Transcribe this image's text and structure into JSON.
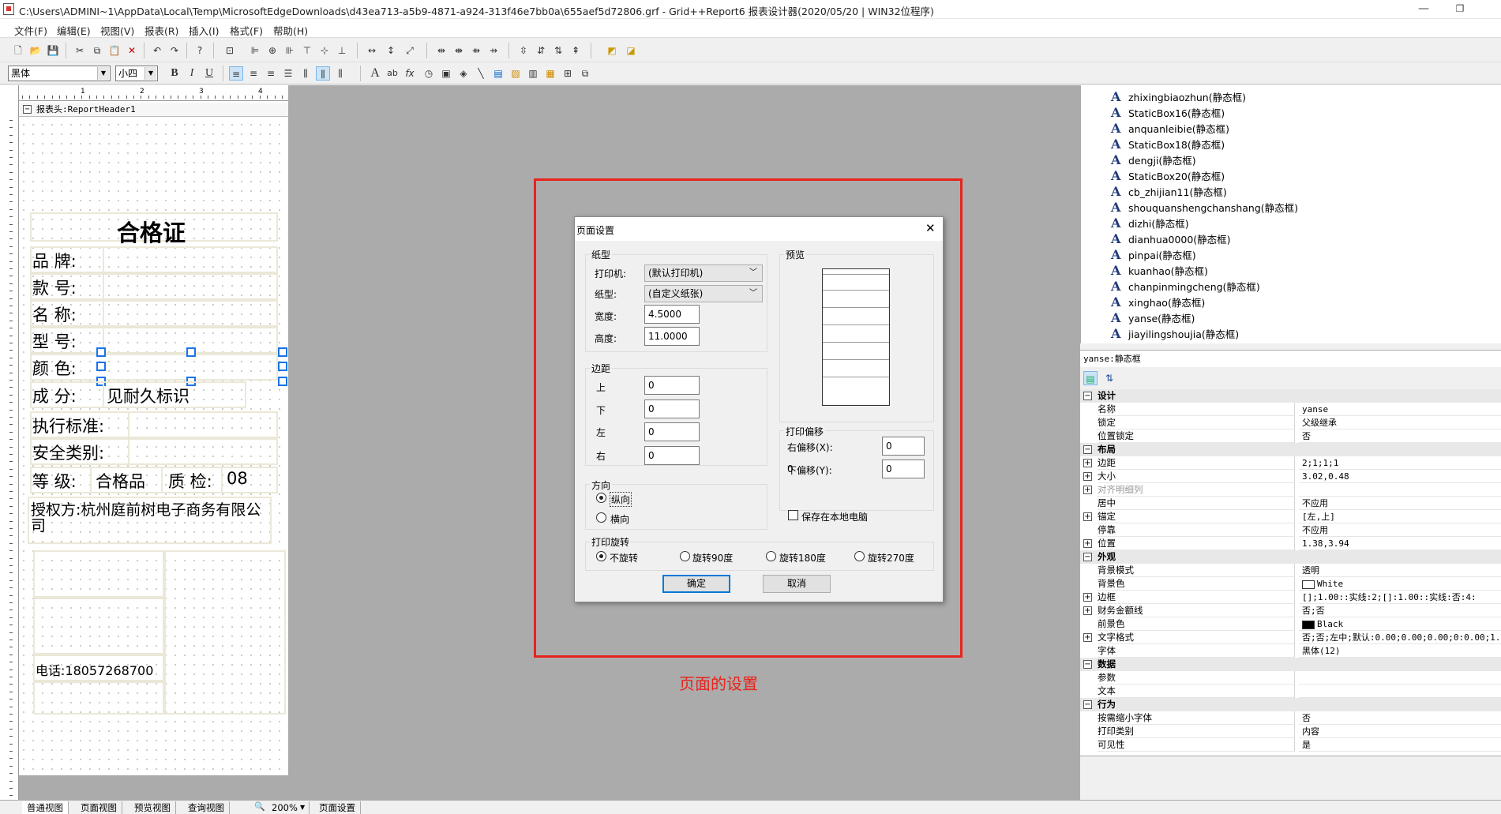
{
  "window": {
    "title": "C:\\Users\\ADMINI~1\\AppData\\Local\\Temp\\MicrosoftEdgeDownloads\\d43ea713-a5b9-4871-a924-313f46e7bb0a\\655aef5d72806.grf - Grid++Report6 报表设计器(2020/05/20 | WIN32位程序)",
    "minimize": "—",
    "restore": "❐"
  },
  "menu": [
    "文件(F)",
    "编辑(E)",
    "视图(V)",
    "报表(R)",
    "插入(I)",
    "格式(F)",
    "帮助(H)"
  ],
  "format_toolbar": {
    "font": "黑体",
    "size": "小四",
    "bold": "B",
    "italic": "I",
    "underline": "U"
  },
  "ruler": [
    "1",
    "2",
    "3",
    "4"
  ],
  "report": {
    "band_header": "报表头:ReportHeader1",
    "title": "合格证",
    "brand": "品  牌:",
    "style": "款  号:",
    "name": "名  称:",
    "model": "型  号:",
    "color": "颜  色:",
    "composition": "成  分:",
    "composition_value": "见耐久标识",
    "standard": "执行标准:",
    "safety": "安全类别:",
    "grade": "等  级:",
    "grade_value": "合格品",
    "qc": "质  检:",
    "qc_value": "08",
    "authorizer": "授权方:杭州庭前树电子商务有限公司",
    "phone": "电话:18057268700"
  },
  "annotation": {
    "caption": "页面的设置",
    "frame_color": "#e8231c"
  },
  "dialog": {
    "title": "页面设置",
    "close": "✕",
    "paper_group": "纸型",
    "printer_label": "打印机:",
    "printer_value": "(默认打印机)",
    "paper_label": "纸型:",
    "paper_value": "(自定义纸张)",
    "width_label": "宽度:",
    "width_value": "4.5000",
    "height_label": "高度:",
    "height_value": "11.0000",
    "margin_group": "边距",
    "top_label": "上",
    "top_value": "0",
    "bottom_label": "下",
    "bottom_value": "0",
    "left_label": "左",
    "left_value": "0",
    "right_label": "右",
    "right_value": "0",
    "direction_group": "方向",
    "portrait": "纵向",
    "landscape": "横向",
    "preview_group": "预览",
    "offset_group": "打印偏移",
    "right_offset_label": "右偏移(X):",
    "right_offset_value": "0",
    "bottom_offset_label": "下偏移(Y):",
    "bottom_offset_value": "0",
    "save_local": "保存在本地电脑",
    "rotate_group": "打印旋转",
    "rot0": "不旋转",
    "rot90": "旋转90度",
    "rot180": "旋转180度",
    "rot270": "旋转270度",
    "ok": "确定",
    "cancel": "取消"
  },
  "tree_items": [
    "zhixingbiaozhun(静态框)",
    "StaticBox16(静态框)",
    "anquanleibie(静态框)",
    "StaticBox18(静态框)",
    "dengji(静态框)",
    "StaticBox20(静态框)",
    "cb_zhijian11(静态框)",
    "shouquanshengchanshang(静态框)",
    "dizhi(静态框)",
    "dianhua0000(静态框)",
    "pinpai(静态框)",
    "kuanhao(静态框)",
    "chanpinmingcheng(静态框)",
    "xinghao(静态框)",
    "yanse(静态框)",
    "jiayilingshoujia(静态框)"
  ],
  "property_header": "yanse:静态框",
  "properties": [
    {
      "cat": true,
      "exp": "⊟",
      "name": "设计"
    },
    {
      "name": "名称",
      "value": "yanse"
    },
    {
      "name": "锁定",
      "value": "父级继承"
    },
    {
      "name": "位置锁定",
      "value": "否"
    },
    {
      "cat": true,
      "exp": "⊟",
      "name": "布局"
    },
    {
      "exp": "⊞",
      "name": "边距",
      "value": "2;1;1;1"
    },
    {
      "exp": "⊞",
      "name": "大小",
      "value": "3.02,0.48"
    },
    {
      "exp": "⊞",
      "name": "对齐明细列",
      "value": "",
      "grey": true
    },
    {
      "name": "居中",
      "value": "不应用"
    },
    {
      "exp": "⊞",
      "name": "锚定",
      "value": "[左,上]"
    },
    {
      "name": "停靠",
      "value": "不应用"
    },
    {
      "exp": "⊞",
      "name": "位置",
      "value": "1.38,3.94"
    },
    {
      "cat": true,
      "exp": "⊟",
      "name": "外观"
    },
    {
      "name": "背景模式",
      "value": "透明"
    },
    {
      "name": "背景色",
      "value": "White",
      "swatch": "#ffffff"
    },
    {
      "exp": "⊞",
      "name": "边框",
      "value": "[];1.00::实线:2;[]:1.00::实线:否:4:"
    },
    {
      "exp": "⊞",
      "name": "财务金额线",
      "value": "否;否"
    },
    {
      "name": "前景色",
      "value": "Black",
      "swatch": "#000000"
    },
    {
      "exp": "⊞",
      "name": "文字格式",
      "value": "否;否;左中;默认:0.00;0.00;0.00;0:0.00;1.00"
    },
    {
      "name": "字体",
      "value": "黑体(12)"
    },
    {
      "cat": true,
      "exp": "⊟",
      "name": "数据"
    },
    {
      "name": "参数",
      "value": ""
    },
    {
      "name": "文本",
      "value": ""
    },
    {
      "cat": true,
      "exp": "⊟",
      "name": "行为"
    },
    {
      "name": "按需缩小字体",
      "value": "否"
    },
    {
      "name": "打印类别",
      "value": "内容"
    },
    {
      "name": "可见性",
      "value": "是"
    }
  ],
  "status_tabs": [
    "普通视图",
    "页面视图",
    "预览视图",
    "查询视图",
    "200%",
    "页面设置"
  ]
}
